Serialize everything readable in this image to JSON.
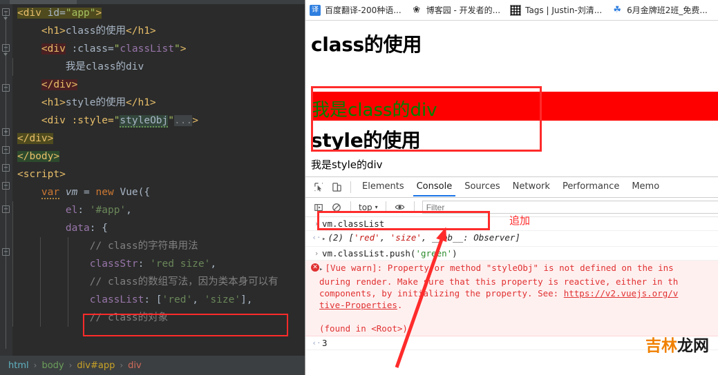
{
  "ide": {
    "code_lines": [
      {
        "indent": 0,
        "highlight": "olive",
        "tokens": [
          {
            "t": "<div ",
            "c": "tag"
          },
          {
            "t": "id=",
            "c": "attr"
          },
          {
            "t": "\"app\"",
            "c": "attrval"
          },
          {
            "t": ">",
            "c": "tag"
          }
        ]
      },
      {
        "indent": 1,
        "tokens": [
          {
            "t": "<h1>",
            "c": "tag"
          },
          {
            "t": "class的使用",
            "c": "txt"
          },
          {
            "t": "</h1>",
            "c": "tag"
          }
        ]
      },
      {
        "indent": 1,
        "highlight": "darkred-tag",
        "tokens": [
          {
            "t": "<div",
            "c": "tag"
          },
          {
            "t": " :class=",
            "c": "attr"
          },
          {
            "t": "\"",
            "c": "attrval"
          },
          {
            "t": "classList",
            "c": "pur"
          },
          {
            "t": "\"",
            "c": "attrval"
          },
          {
            "t": ">",
            "c": "tag"
          }
        ]
      },
      {
        "indent": 2,
        "tokens": [
          {
            "t": "我是class的div",
            "c": "txt"
          }
        ]
      },
      {
        "indent": 1,
        "highlight": "darkred",
        "tokens": [
          {
            "t": "</div>",
            "c": "tag"
          }
        ]
      },
      {
        "indent": 1,
        "tokens": [
          {
            "t": "<h1>",
            "c": "tag"
          },
          {
            "t": "style的使用",
            "c": "txt"
          },
          {
            "t": "</h1>",
            "c": "tag"
          }
        ]
      },
      {
        "indent": 1,
        "tokens": [
          {
            "t": "<div :style=",
            "c": "tag"
          },
          {
            "t": "\"",
            "c": "attrval"
          },
          {
            "t": "styleObj",
            "c": "styleobj"
          },
          {
            "t": "\"",
            "c": "attrval"
          },
          {
            "t": "...",
            "c": "fold"
          },
          {
            "t": ">",
            "c": "tag"
          }
        ]
      },
      {
        "indent": 0,
        "highlight": "olive",
        "tokens": [
          {
            "t": "</div>",
            "c": "tag"
          }
        ]
      },
      {
        "indent": 0,
        "highlight": "green",
        "tokens": [
          {
            "t": "</body>",
            "c": "tag"
          }
        ]
      },
      {
        "indent": 0,
        "tokens": [
          {
            "t": "<script>",
            "c": "tag"
          }
        ]
      },
      {
        "indent": 1,
        "tokens": [
          {
            "t": "var",
            "c": "kw-squig"
          },
          {
            "t": " ",
            "c": "txt"
          },
          {
            "t": "vm",
            "c": "varname"
          },
          {
            "t": " = ",
            "c": "txt"
          },
          {
            "t": "new",
            "c": "kw"
          },
          {
            "t": " ",
            "c": "txt"
          },
          {
            "t": "Vue",
            "c": "cls"
          },
          {
            "t": "({",
            "c": "txt"
          }
        ]
      },
      {
        "indent": 2,
        "tokens": [
          {
            "t": "el",
            "c": "pur"
          },
          {
            "t": ": ",
            "c": "txt"
          },
          {
            "t": "'#app'",
            "c": "str"
          },
          {
            "t": ",",
            "c": "txt"
          }
        ]
      },
      {
        "indent": 2,
        "tokens": [
          {
            "t": "data",
            "c": "pur"
          },
          {
            "t": ": {",
            "c": "txt"
          }
        ]
      },
      {
        "indent": 3,
        "tokens": [
          {
            "t": "// class的字符串用法",
            "c": "cmt"
          }
        ]
      },
      {
        "indent": 3,
        "tokens": [
          {
            "t": "classStr",
            "c": "pur"
          },
          {
            "t": ": ",
            "c": "txt"
          },
          {
            "t": "'red size'",
            "c": "str"
          },
          {
            "t": ",",
            "c": "txt"
          }
        ]
      },
      {
        "indent": 3,
        "tokens": [
          {
            "t": "// class的数组写法，因为类本身可以有",
            "c": "cmt"
          }
        ]
      },
      {
        "indent": 3,
        "tokens": [
          {
            "t": "classList",
            "c": "pur"
          },
          {
            "t": ": [",
            "c": "txt"
          },
          {
            "t": "'red'",
            "c": "str"
          },
          {
            "t": ", ",
            "c": "txt"
          },
          {
            "t": "'size'",
            "c": "str"
          },
          {
            "t": "],",
            "c": "txt"
          }
        ]
      },
      {
        "indent": 3,
        "tokens": [
          {
            "t": "// class的对象",
            "c": "cmt"
          }
        ]
      }
    ],
    "breadcrumb": {
      "html": "html",
      "body": "body",
      "divapp": "div#app",
      "div": "div",
      "sep": "›"
    }
  },
  "browser": {
    "bookmarks": [
      {
        "icon": "translate-icon",
        "glyph": "译",
        "label": "百度翻译-200种语..."
      },
      {
        "icon": "cnblogs-icon",
        "glyph": "❀",
        "label": "博客园 - 开发者的..."
      },
      {
        "icon": "qrcode-icon",
        "glyph": "",
        "label": "Tags | Justin-刘清..."
      },
      {
        "icon": "flower-icon",
        "glyph": "☘",
        "label": "6月金牌班2班_免费..."
      }
    ],
    "page": {
      "heading_class": "class的使用",
      "class_div_text": "我是class的div",
      "heading_style": "style的使用",
      "style_div_text": "我是style的div"
    }
  },
  "devtools": {
    "tabs": [
      {
        "label": "Elements",
        "active": false
      },
      {
        "label": "Console",
        "active": true
      },
      {
        "label": "Sources",
        "active": false
      },
      {
        "label": "Network",
        "active": false
      },
      {
        "label": "Performance",
        "active": false
      },
      {
        "label": "Memo",
        "active": false
      }
    ],
    "icons": {
      "inspect": "inspect-element-icon",
      "device": "device-toolbar-icon",
      "sidebar": "console-sidebar-icon",
      "clear": "clear-console-icon",
      "eye": "live-expression-icon"
    },
    "filter_bar": {
      "context": "top",
      "caret": "▾",
      "filter_placeholder": "Filter"
    },
    "console_rows": [
      {
        "type": "input",
        "marker": "›",
        "text": "vm.classList"
      },
      {
        "type": "result",
        "marker": "‹·",
        "parts": [
          {
            "t": "(2) ",
            "c": "ob-n"
          },
          {
            "t": "[",
            "c": "ob-n"
          },
          {
            "t": "'red'",
            "c": "ob-str"
          },
          {
            "t": ", ",
            "c": "ob-n"
          },
          {
            "t": "'size'",
            "c": "ob-str"
          },
          {
            "t": ", __ob__: ",
            "c": "ob-n"
          },
          {
            "t": "Observer",
            "c": "ob-obs"
          },
          {
            "t": "]",
            "c": "ob-n"
          }
        ]
      },
      {
        "type": "input",
        "marker": "›",
        "parts": [
          {
            "t": "vm.classList.push(",
            "c": "c-txt"
          },
          {
            "t": "'green'",
            "c": "kwgreen"
          },
          {
            "t": ")",
            "c": "c-txt"
          }
        ]
      },
      {
        "type": "error",
        "marker": "✕",
        "lines": [
          "[Vue warn]: Property or method \"styleObj\" is not defined on the ins",
          "during render. Make sure that this property is reactive, either in th",
          "components, by initializing the property. See: https://v2.vuejs.org/v",
          "tive-Properties.",
          "",
          "(found in <Root>)"
        ],
        "link1": "https://v2.vuejs.org/v",
        "link2": "tive-Properties"
      },
      {
        "type": "result",
        "marker": "‹·",
        "text": "3"
      }
    ],
    "annotation": "追加",
    "watermark": {
      "orange": "吉林",
      "black": "龙网"
    }
  },
  "colors": {
    "annotation_red": "#ff2b2b",
    "page_band_red": "#ff0000",
    "class_div_green": "#008000",
    "devtools_accent": "#1a73e8",
    "error_red": "#e03131"
  }
}
